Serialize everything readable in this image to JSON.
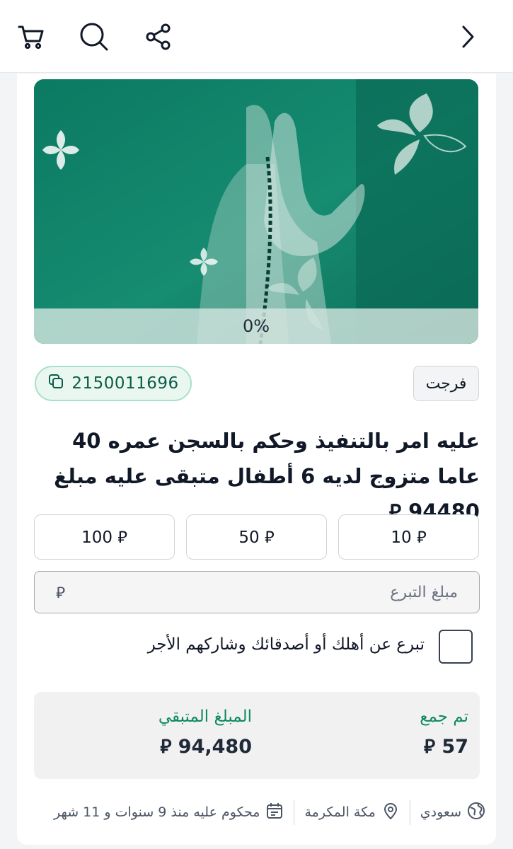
{
  "header": {
    "back_icon": "chevron-right-icon",
    "share_icon": "share-icon",
    "search_icon": "search-icon",
    "cart_icon": "cart-icon"
  },
  "campaign": {
    "progress_percent_label": "0%",
    "progress_fraction": 0,
    "code": "2150011696",
    "category": "فرجت",
    "title": "عليه امر بالتنفيذ وحكم بالسجن عمره 40 عاما متزوج لديه 6 أطفال متبقى عليه مبلغ 94480 ⃁"
  },
  "donate": {
    "amounts": [
      {
        "label": "10 ⃁"
      },
      {
        "label": "50 ⃁"
      },
      {
        "label": "100 ⃁"
      }
    ],
    "input_placeholder": "مبلغ التبرع",
    "currency_symbol": "⃁",
    "gift_label": "تبرع عن أهلك أو أصدقائك وشاركهم الأجر"
  },
  "stats": {
    "collected_label": "تم جمع",
    "collected_value": "57 ⃁",
    "remaining_label": "المبلغ المتبقي",
    "remaining_value": "94,480 ⃁"
  },
  "meta": {
    "nationality": "سعودي",
    "city": "مكة المكرمة",
    "sentence": "محكوم عليه منذ 9 سنوات و 11 شهر"
  },
  "colors": {
    "brand_green": "#0f7a63",
    "accent_green": "#0f8a5f",
    "badge_bg": "#eaf7f1"
  }
}
